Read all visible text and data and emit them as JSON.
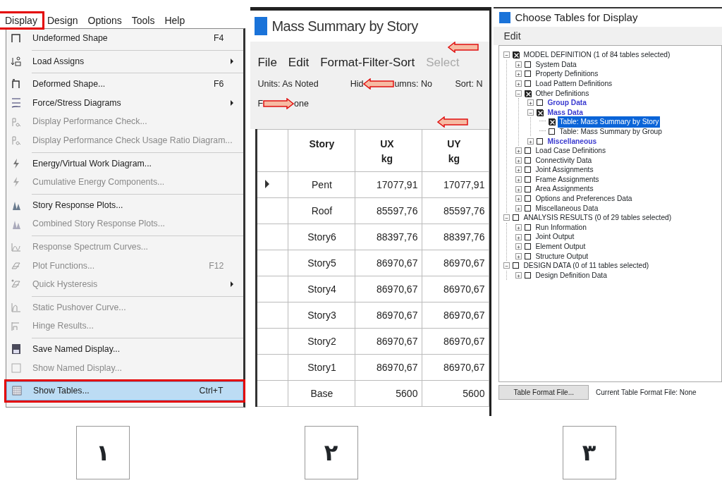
{
  "panel_1": {
    "menu_bar": [
      {
        "label": "Display",
        "marked": true
      },
      {
        "label": "Design",
        "marked": false
      },
      {
        "label": "Options",
        "marked": false
      },
      {
        "label": "Tools",
        "marked": false
      },
      {
        "label": "Help",
        "marked": false
      }
    ],
    "menu_items": [
      {
        "label": "Undeformed Shape",
        "shortcut": "F4",
        "submenu": false,
        "disabled": false,
        "selected": false,
        "marked": false,
        "separator_after": true
      },
      {
        "label": "Load Assigns",
        "submenu": true,
        "disabled": false,
        "selected": false,
        "marked": false,
        "separator_after": true
      },
      {
        "label": "Deformed Shape...",
        "shortcut": "F6",
        "submenu": false,
        "disabled": false,
        "selected": false,
        "marked": false,
        "separator_after": false
      },
      {
        "label": "Force/Stress Diagrams",
        "submenu": true,
        "disabled": false,
        "selected": false,
        "marked": false,
        "separator_after": false
      },
      {
        "label": "Display Performance Check...",
        "submenu": false,
        "disabled": true,
        "selected": false,
        "marked": false,
        "separator_after": false
      },
      {
        "label": "Display Performance Check Usage Ratio Diagram...",
        "submenu": false,
        "disabled": true,
        "selected": false,
        "marked": false,
        "separator_after": true
      },
      {
        "label": "Energy/Virtual Work Diagram...",
        "submenu": false,
        "disabled": false,
        "selected": false,
        "marked": false,
        "separator_after": false
      },
      {
        "label": "Cumulative Energy Components...",
        "submenu": false,
        "disabled": true,
        "selected": false,
        "marked": false,
        "separator_after": true
      },
      {
        "label": "Story Response Plots...",
        "submenu": false,
        "disabled": false,
        "selected": false,
        "marked": false,
        "separator_after": false
      },
      {
        "label": "Combined Story Response Plots...",
        "submenu": false,
        "disabled": true,
        "selected": false,
        "marked": false,
        "separator_after": true
      },
      {
        "label": "Response Spectrum Curves...",
        "submenu": false,
        "disabled": true,
        "selected": false,
        "marked": false,
        "separator_after": false
      },
      {
        "label": "Plot Functions...",
        "shortcut": "F12",
        "submenu": false,
        "disabled": true,
        "selected": false,
        "marked": false,
        "separator_after": false
      },
      {
        "label": "Quick Hysteresis",
        "submenu": true,
        "disabled": true,
        "selected": false,
        "marked": false,
        "separator_after": true
      },
      {
        "label": "Static Pushover Curve...",
        "submenu": false,
        "disabled": true,
        "selected": false,
        "marked": false,
        "separator_after": false
      },
      {
        "label": "Hinge Results...",
        "submenu": false,
        "disabled": true,
        "selected": false,
        "marked": false,
        "separator_after": true
      },
      {
        "label": "Save Named Display...",
        "submenu": false,
        "disabled": false,
        "selected": false,
        "marked": false,
        "separator_after": false
      },
      {
        "label": "Show Named Display...",
        "submenu": false,
        "disabled": true,
        "selected": false,
        "marked": false,
        "separator_after": true
      },
      {
        "label": "Show Tables...",
        "shortcut": "Ctrl+T",
        "submenu": false,
        "disabled": false,
        "selected": true,
        "marked": true,
        "separator_after": false
      }
    ],
    "step_label": "۱"
  },
  "panel_2": {
    "window": {
      "title": "Mass Summary by Story"
    },
    "menu_bar": [
      {
        "label": "File",
        "disabled": false
      },
      {
        "label": "Edit",
        "disabled": false
      },
      {
        "label": "Format-Filter-Sort",
        "disabled": false
      },
      {
        "label": "Select",
        "disabled": true
      }
    ],
    "info_line_1": {
      "units": "Units:  As Noted",
      "hidden_columns_start": "Hid",
      "hidden_columns_end": "umns:  No",
      "sort": "Sort:  N"
    },
    "info_line_2": {
      "filter_start": "F",
      "filter_end": "one"
    },
    "table": {
      "columns": [
        {
          "name": "Story"
        },
        {
          "name": "UX",
          "unit": "kg"
        },
        {
          "name": "UY",
          "unit": "kg"
        }
      ],
      "rows": [
        {
          "current": true,
          "cells": [
            "Pent",
            "17077,91",
            "17077,91"
          ]
        },
        {
          "current": false,
          "cells": [
            "Roof",
            "85597,76",
            "85597,76"
          ]
        },
        {
          "current": false,
          "cells": [
            "Story6",
            "88397,76",
            "88397,76"
          ]
        },
        {
          "current": false,
          "cells": [
            "Story5",
            "86970,67",
            "86970,67"
          ]
        },
        {
          "current": false,
          "cells": [
            "Story4",
            "86970,67",
            "86970,67"
          ]
        },
        {
          "current": false,
          "cells": [
            "Story3",
            "86970,67",
            "86970,67"
          ]
        },
        {
          "current": false,
          "cells": [
            "Story2",
            "86970,67",
            "86970,67"
          ]
        },
        {
          "current": false,
          "cells": [
            "Story1",
            "86970,67",
            "86970,67"
          ]
        },
        {
          "current": false,
          "cells": [
            "Base",
            "5600",
            "5600"
          ]
        }
      ]
    },
    "step_label": "۲"
  },
  "panel_3": {
    "window": {
      "title": "Choose Tables for Display"
    },
    "menu_bar": [
      {
        "label": "Edit"
      }
    ],
    "tree": [
      {
        "label": "MODEL DEFINITION  (1 of 84 tables selected)",
        "checked": true,
        "expanded": true,
        "selected": false,
        "children": [
          {
            "label": "System Data",
            "checked": false,
            "expanded": false,
            "selected": false
          },
          {
            "label": "Property Definitions",
            "checked": false,
            "expanded": false,
            "selected": false
          },
          {
            "label": "Load Pattern Definitions",
            "checked": false,
            "expanded": false,
            "selected": false
          },
          {
            "label": "Other Definitions",
            "checked": true,
            "expanded": true,
            "selected": false,
            "children": [
              {
                "label": "Group Data",
                "checked": false,
                "expanded": false,
                "selected": false,
                "color": "#3b3bd0"
              },
              {
                "label": "Mass Data",
                "checked": true,
                "expanded": true,
                "selected": false,
                "color": "#3b3bd0",
                "children": [
                  {
                    "label": "Table:  Mass Summary by Story",
                    "checked": true,
                    "selected": true
                  },
                  {
                    "label": "Table:  Mass Summary by Group",
                    "checked": false,
                    "selected": false
                  }
                ]
              },
              {
                "label": "Miscellaneous",
                "checked": false,
                "expanded": false,
                "selected": false,
                "color": "#3b3bd0"
              }
            ]
          },
          {
            "label": "Load Case Definitions",
            "checked": false,
            "expanded": false,
            "selected": false
          },
          {
            "label": "Connectivity Data",
            "checked": false,
            "expanded": false,
            "selected": false
          },
          {
            "label": "Joint Assignments",
            "checked": false,
            "expanded": false,
            "selected": false
          },
          {
            "label": "Frame Assignments",
            "checked": false,
            "expanded": false,
            "selected": false
          },
          {
            "label": "Area Assignments",
            "checked": false,
            "expanded": false,
            "selected": false
          },
          {
            "label": "Options and Preferences Data",
            "checked": false,
            "expanded": false,
            "selected": false
          },
          {
            "label": "Miscellaneous Data",
            "checked": false,
            "expanded": false,
            "selected": false
          }
        ]
      },
      {
        "label": "ANALYSIS RESULTS  (0 of 29 tables selected)",
        "checked": false,
        "expanded": true,
        "selected": false,
        "children": [
          {
            "label": "Run Information",
            "checked": false,
            "expanded": false,
            "selected": false
          },
          {
            "label": "Joint Output",
            "checked": false,
            "expanded": false,
            "selected": false
          },
          {
            "label": "Element Output",
            "checked": false,
            "expanded": false,
            "selected": false
          },
          {
            "label": "Structure Output",
            "checked": false,
            "expanded": false,
            "selected": false
          }
        ]
      },
      {
        "label": "DESIGN DATA  (0 of 11 tables selected)",
        "checked": false,
        "expanded": true,
        "selected": false,
        "children": [
          {
            "label": "Design Definition Data",
            "checked": false,
            "expanded": false,
            "selected": false
          }
        ]
      }
    ],
    "footer": {
      "button": "Table Format File...",
      "label": "Current Table Format File:  None"
    },
    "step_label": "۳"
  }
}
